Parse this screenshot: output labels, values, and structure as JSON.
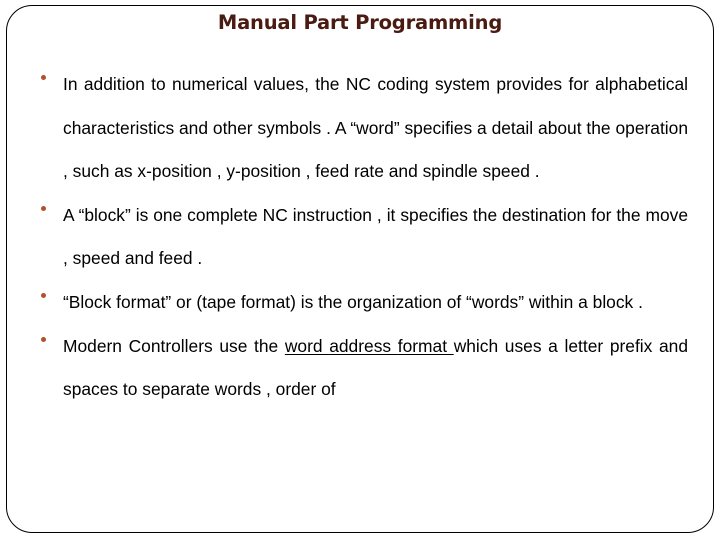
{
  "slide": {
    "title": "Manual Part Programming",
    "title_color": "#4a1b11",
    "bullet_color": "#b0522a",
    "text_color": "#000000",
    "background_color": "#ffffff",
    "border_color": "#000000"
  },
  "bullets": [
    {
      "marker": "round-bullet",
      "text_part_1": "In addition to numerical values, the NC coding system provides for   alphabetical characteristics and other symbols . A “word” specifies a detail about the operation , such as x-position , y-position , feed rate and spindle speed ."
    },
    {
      "marker": "round-bullet",
      "text_part_1": "A “block” is one complete NC instruction , it specifies the destination for the move , speed and feed ."
    },
    {
      "marker": "round-bullet",
      "text_part_1": "“Block format” or (tape format) is the organization of “words” within a block ."
    },
    {
      "marker": "round-bullet",
      "text_before_underline": "Modern Controllers use the ",
      "underlined_1": "word ",
      "underlined_2": "address ",
      "underlined_3": "format ",
      "text_after_underline": "which uses a letter prefix and spaces to separate words , order of"
    }
  ]
}
